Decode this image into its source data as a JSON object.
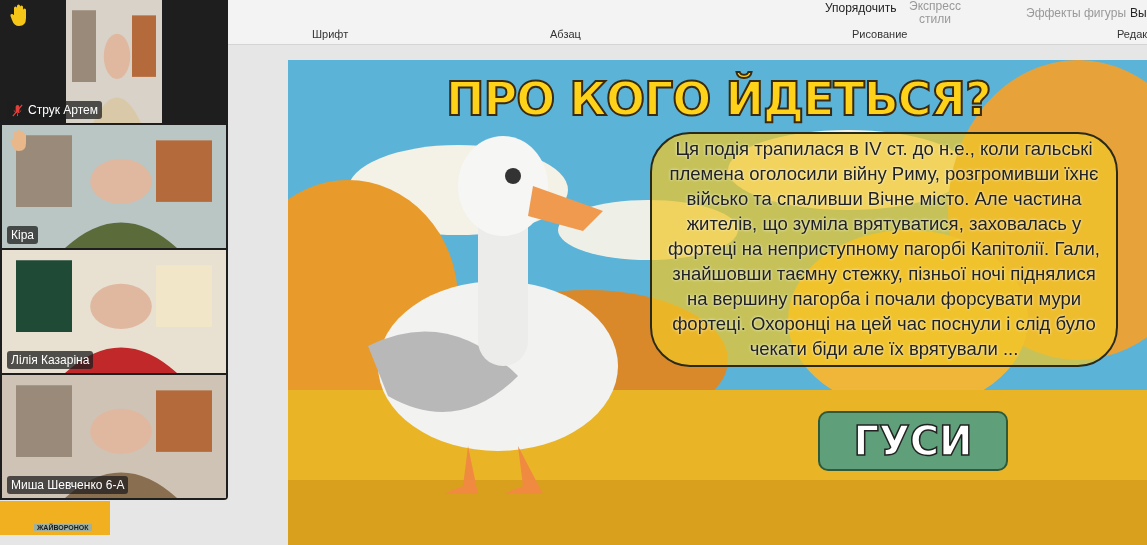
{
  "ribbon": {
    "partial_items": [
      "Упорядочить",
      "Экспресс стили",
      "Эффекты фигуры",
      "Вы"
    ],
    "groups": [
      "Шрифт",
      "Абзац",
      "Рисование",
      "Редак"
    ]
  },
  "participants": [
    {
      "name": "Струк Артем",
      "hand_raised": true,
      "muted": true
    },
    {
      "name": "Кіра",
      "hand_raised": true,
      "muted": false
    },
    {
      "name": "Лілія Казаріна",
      "hand_raised": false,
      "muted": false
    },
    {
      "name": "Миша Шевченко 6-А",
      "hand_raised": false,
      "muted": false
    }
  ],
  "thumbnail": {
    "label": "ЖАЙВОРОНОК"
  },
  "slide": {
    "title": "ПРО КОГО ЙДЕТЬСЯ?",
    "text": "Ця подія трапилася в IV ст. до н.е., коли гальські племена оголосили війну Риму, розгромивши їхнє військо та спаливши Вічне місто. Але частина жителів, що зуміла врятуватися, заховалась у фортеці на неприступному пагорбі Капітолії.  Гали, знайшовши таємну стежку, пізньої ночі піднялися на вершину пагорба і почали форсувати мури фортеці. Охоронці на цей час поснули і слід було чекати біди але їх врятували ...",
    "answer_button": "ГУСИ"
  }
}
